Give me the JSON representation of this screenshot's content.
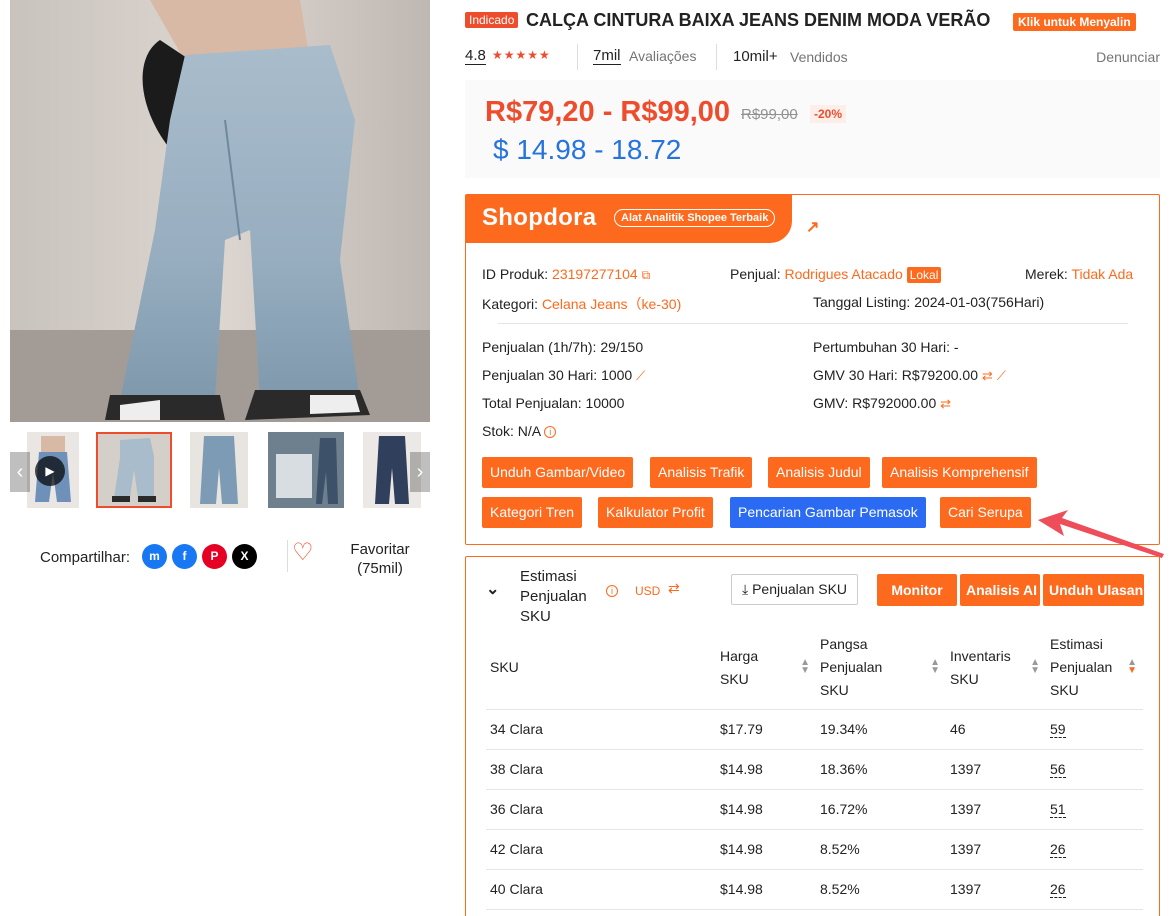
{
  "gallery": {
    "thumbs_count": 5,
    "active_thumb": 1
  },
  "share": {
    "label": "Compartilhar:",
    "favorite_label": "Favoritar",
    "favorite_count": "(75mil)"
  },
  "product": {
    "badge": "Indicado",
    "title": "CALÇA CINTURA BAIXA JEANS DENIM MODA VERÃO",
    "copy_button": "Klik untuk Menyalin",
    "rating": "4.8",
    "stars": "★★★★★",
    "reviews_count": "7mil",
    "reviews_label": "Avaliações",
    "sold_count": "10mil+",
    "sold_label": "Vendidos",
    "report": "Denunciar",
    "price_range": "R$79,20 - R$99,00",
    "price_original": "R$99,00",
    "discount": "-20%",
    "price_usd": "$ 14.98 - 18.72"
  },
  "shopdora": {
    "logo": "Shopdora",
    "tagline": "Alat Analitik Shopee Terbaik",
    "product_id_label": "ID Produk:",
    "product_id": "23197277104",
    "seller_label": "Penjual:",
    "seller": "Rodrigues Atacado",
    "seller_badge": "Lokal",
    "brand_label": "Merek:",
    "brand": "Tidak Ada",
    "category_label": "Kategori:",
    "category": "Celana Jeans（ke-30)",
    "listing_label": "Tanggal Listing:",
    "listing": "2024-01-03(756Hari)",
    "sales_1h7h_label": "Penjualan (1h/7h):",
    "sales_1h7h": "29/150",
    "growth_label": "Pertumbuhan 30 Hari:",
    "growth": "-",
    "sales_30d_label": "Penjualan 30 Hari:",
    "sales_30d": "1000",
    "gmv_30d_label": "GMV 30 Hari:",
    "gmv_30d": "R$79200.00",
    "total_sales_label": "Total Penjualan:",
    "total_sales": "10000",
    "gmv_label": "GMV:",
    "gmv": "R$792000.00",
    "stock_label": "Stok:",
    "stock": "N/A",
    "buttons": {
      "download_media": "Unduh Gambar/Video",
      "traffic": "Analisis Trafik",
      "title_analysis": "Analisis Judul",
      "comprehensive": "Analisis Komprehensif",
      "trend_category": "Kategori Tren",
      "profit_calc": "Kalkulator Profit",
      "supplier_search": "Pencarian Gambar Pemasok",
      "find_similar": "Cari Serupa"
    }
  },
  "sku_panel": {
    "title": "Estimasi Penjualan SKU",
    "currency": "USD",
    "sku_sales_button": "Penjualan SKU",
    "monitor_button": "Monitor",
    "ai_button": "Analisis AI",
    "reviews_button": "Unduh Ulasan",
    "columns": [
      "SKU",
      "Harga SKU",
      "Pangsa Penjualan SKU",
      "Inventaris SKU",
      "Estimasi Penjualan SKU"
    ],
    "rows": [
      {
        "sku": "34 Clara",
        "price": "$17.79",
        "share": "19.34%",
        "inventory": "46",
        "est": "59"
      },
      {
        "sku": "38 Clara",
        "price": "$14.98",
        "share": "18.36%",
        "inventory": "1397",
        "est": "56"
      },
      {
        "sku": "36 Clara",
        "price": "$14.98",
        "share": "16.72%",
        "inventory": "1397",
        "est": "51"
      },
      {
        "sku": "42 Clara",
        "price": "$14.98",
        "share": "8.52%",
        "inventory": "1397",
        "est": "26"
      },
      {
        "sku": "40 Clara",
        "price": "$14.98",
        "share": "8.52%",
        "inventory": "1397",
        "est": "26"
      }
    ]
  },
  "colors": {
    "shopee_orange": "#ee4d2d",
    "shopdora_orange": "#fd6a1e",
    "usd_blue": "#2673dd",
    "button_blue": "#2b6bf3"
  }
}
